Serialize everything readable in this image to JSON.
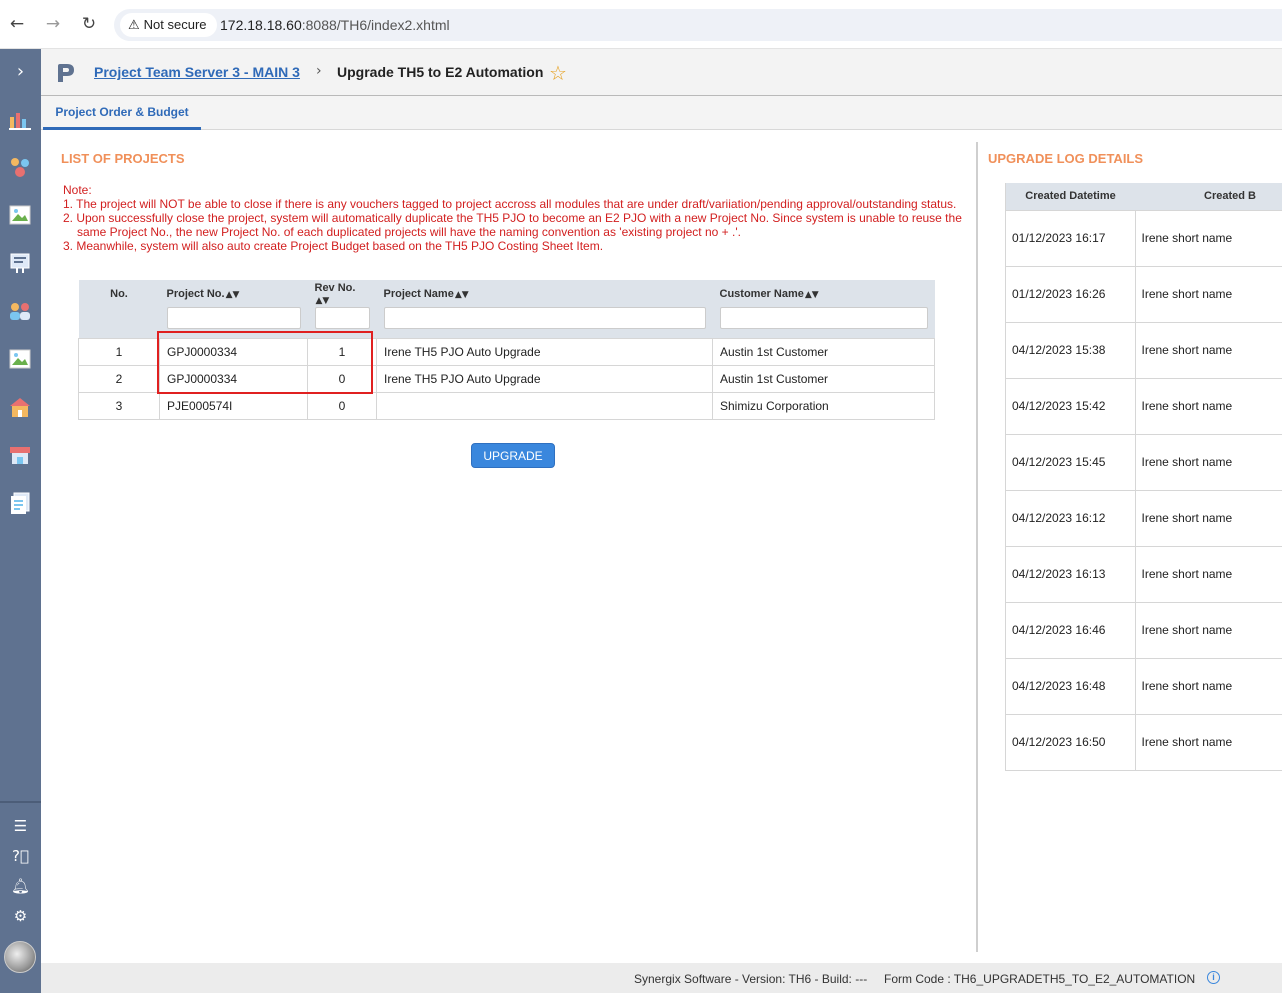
{
  "browser": {
    "security_label": "Not secure",
    "url_host": "172.18.18.60",
    "url_path": ":8088/TH6/index2.xhtml"
  },
  "header": {
    "breadcrumb_link": "Project Team Server 3 - MAIN 3",
    "current_page": "Upgrade TH5 to E2 Automation"
  },
  "tabs": [
    {
      "label": "Project Order & Budget",
      "active": true
    }
  ],
  "projects_section": {
    "title": "LIST OF PROJECTS",
    "note_label": "Note:",
    "notes": [
      "1. The project will NOT be able to close if there is any vouchers tagged to project accross all modules that are under draft/variiation/pending approval/outstanding status.",
      "2. Upon successfully close the project, system will automatically duplicate the TH5 PJO to become an E2 PJO with a new Project No. Since system is unable to reuse the",
      "same Project No., the new Project No. of each duplicated projects will have the naming convention as 'existing project no + .'.",
      "3. Meanwhile, system will also auto create Project Budget based on the TH5 PJO Costing Sheet Item."
    ],
    "columns": {
      "no": "No.",
      "project_no": "Project No.",
      "rev_no": "Rev No.",
      "project_name": "Project Name",
      "customer_name": "Customer Name"
    },
    "rows": [
      {
        "no": "1",
        "project_no": "GPJ0000334",
        "rev_no": "1",
        "project_name": "Irene TH5 PJO Auto Upgrade",
        "customer_name": "Austin 1st Customer"
      },
      {
        "no": "2",
        "project_no": "GPJ0000334",
        "rev_no": "0",
        "project_name": "Irene TH5 PJO Auto Upgrade",
        "customer_name": "Austin 1st Customer"
      },
      {
        "no": "3",
        "project_no": "PJE000574I",
        "rev_no": "0",
        "project_name": "",
        "customer_name": "Shimizu Corporation"
      }
    ],
    "upgrade_button": "UPGRADE"
  },
  "log_section": {
    "title": "UPGRADE LOG DETAILS",
    "columns": {
      "created_datetime": "Created Datetime",
      "created_by": "Created B"
    },
    "rows": [
      {
        "datetime": "01/12/2023 16:17",
        "by": "Irene short name"
      },
      {
        "datetime": "01/12/2023 16:26",
        "by": "Irene short name"
      },
      {
        "datetime": "04/12/2023 15:38",
        "by": "Irene short name"
      },
      {
        "datetime": "04/12/2023 15:42",
        "by": "Irene short name"
      },
      {
        "datetime": "04/12/2023 15:45",
        "by": "Irene short name"
      },
      {
        "datetime": "04/12/2023 16:12",
        "by": "Irene short name"
      },
      {
        "datetime": "04/12/2023 16:13",
        "by": "Irene short name"
      },
      {
        "datetime": "04/12/2023 16:46",
        "by": "Irene short name"
      },
      {
        "datetime": "04/12/2023 16:48",
        "by": "Irene short name"
      },
      {
        "datetime": "04/12/2023 16:50",
        "by": "Irene short name"
      }
    ]
  },
  "footer": {
    "version": "Synergix Software - Version: TH6 - Build: ---",
    "form_code": "Form Code : TH6_UPGRADETH5_TO_E2_AUTOMATION"
  },
  "sidebar": {
    "icons": [
      "analytics-icon",
      "people-network-icon",
      "broken-image-icon",
      "document-board-icon",
      "team-icon",
      "broken-image-icon",
      "house-icon",
      "store-icon",
      "forms-icon"
    ],
    "bottom_icons": [
      "menu-icon",
      "help-icon",
      "bell-icon",
      "gear-icon"
    ]
  },
  "colors": {
    "sidebar": "#5f7290",
    "accent": "#2f6ab8",
    "section_title": "#f0905a",
    "note_text": "#d22020",
    "button": "#3a87dd"
  }
}
